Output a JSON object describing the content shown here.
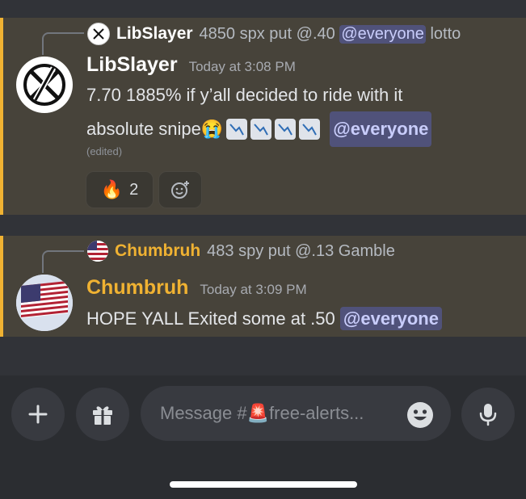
{
  "messages": [
    {
      "reply": {
        "author": "LibSlayer",
        "text_before": "4850 spx put @.40",
        "mention": "@everyone",
        "text_after": "lotto"
      },
      "author": "LibSlayer",
      "author_color": "#ffffff",
      "timestamp": "Today at 3:08 PM",
      "line1": "7.70 1885% if y’all decided to ride with it",
      "line2": "absolute snipe",
      "mention": "@everyone",
      "edited": "(edited)",
      "reactions": [
        {
          "emoji": "🔥",
          "count": "2"
        }
      ]
    },
    {
      "reply": {
        "author": "Chumbruh",
        "text_before": "483 spy put @.13 Gamble"
      },
      "author": "Chumbruh",
      "author_color": "#f0b232",
      "timestamp": "Today at 3:09 PM",
      "text": "HOPE YALL Exited some at .50",
      "mention": "@everyone"
    }
  ],
  "composer": {
    "placeholder_prefix": "Message #",
    "channel_emoji": "🚨",
    "placeholder_suffix": "free-alerts..."
  },
  "icons": [
    "plus-icon",
    "gift-icon",
    "emoji-smile-icon",
    "microphone-icon",
    "add-reaction-icon"
  ]
}
